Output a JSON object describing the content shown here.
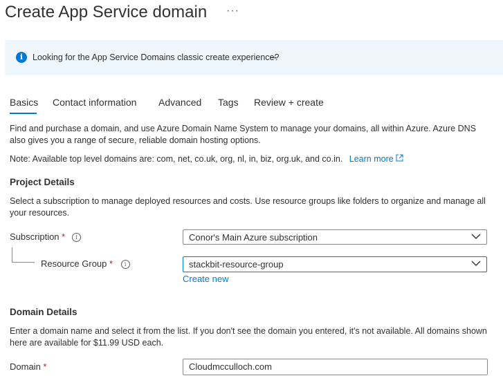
{
  "header": {
    "title": "Create App Service domain",
    "more": "···"
  },
  "banner": {
    "icon": "info-icon",
    "text": "Looking for the App Service Domains classic create experience?",
    "arrow": "→"
  },
  "tabs": [
    {
      "label": "Basics",
      "active": true
    },
    {
      "label": "Contact information",
      "active": false
    },
    {
      "label": "Advanced",
      "active": false
    },
    {
      "label": "Tags",
      "active": false
    },
    {
      "label": "Review + create",
      "active": false
    }
  ],
  "intro": {
    "description": "Find and purchase a domain, and use Azure Domain Name System to manage your domains, all within Azure. Azure DNS also gives you a range of secure, reliable domain hosting options.",
    "note": "Note: Available top level domains are: com, net, co.uk, org, nl, in, biz, org.uk, and co.in.",
    "learn_more": "Learn more"
  },
  "project": {
    "heading": "Project Details",
    "description": "Select a subscription to manage deployed resources and costs. Use resource groups like folders to organize and manage all your resources.",
    "subscription_label": "Subscription",
    "subscription_value": "Conor's Main Azure subscription",
    "resource_group_label": "Resource Group",
    "resource_group_value": "stackbit-resource-group",
    "create_new": "Create new"
  },
  "domain": {
    "heading": "Domain Details",
    "description": "Enter a domain name and select it from the list. If you don't see the domain you entered, it's not available. All domains shown here are available for $11.99 USD each.",
    "domain_label": "Domain",
    "domain_value": "Cloudmcculloch.com"
  },
  "required_marker": "*",
  "colors": {
    "accent": "#0078d4",
    "banner_bg": "#eff6fc",
    "required": "#a4262c"
  }
}
